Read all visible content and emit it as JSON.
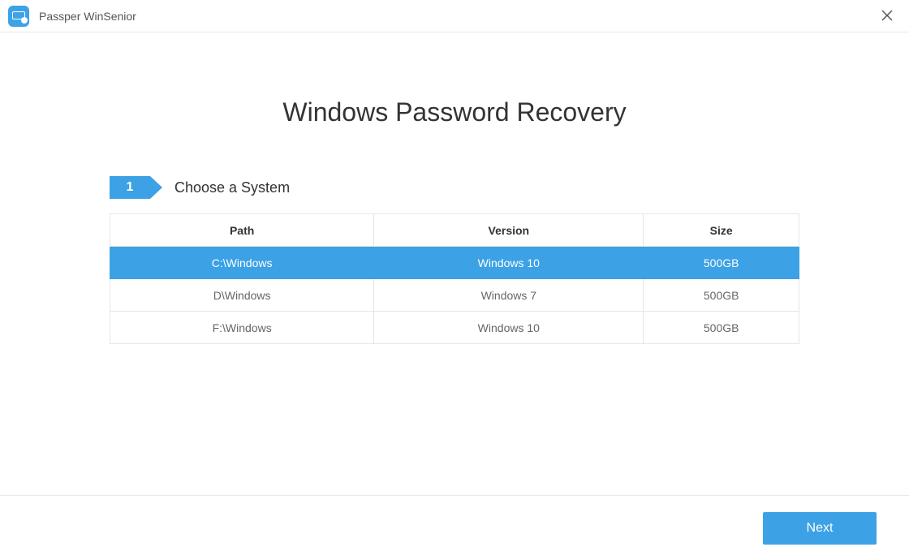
{
  "app": {
    "title": "Passper WinSenior",
    "icon": "monitor-lock-icon"
  },
  "page": {
    "title": "Windows Password Recovery"
  },
  "step": {
    "number": "1",
    "label": "Choose a System"
  },
  "table": {
    "headers": {
      "path": "Path",
      "version": "Version",
      "size": "Size"
    },
    "rows": [
      {
        "path": "C:\\Windows",
        "version": "Windows 10",
        "size": "500GB",
        "selected": true
      },
      {
        "path": "D\\Windows",
        "version": "Windows 7",
        "size": "500GB",
        "selected": false
      },
      {
        "path": "F:\\Windows",
        "version": "Windows 10",
        "size": "500GB",
        "selected": false
      }
    ]
  },
  "footer": {
    "next_label": "Next"
  }
}
